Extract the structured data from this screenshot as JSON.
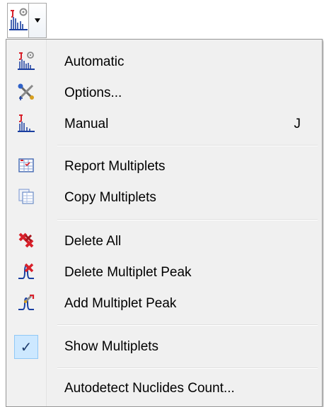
{
  "toolbar": {
    "button_icon": "multiplet-auto-icon",
    "dropdown_icon": "chevron-down-icon"
  },
  "menu": {
    "groups": [
      {
        "items": [
          {
            "label": "Automatic",
            "icon": "multiplet-auto-icon",
            "shortcut": ""
          },
          {
            "label": "Options...",
            "icon": "options-wrench-icon",
            "shortcut": ""
          },
          {
            "label": "Manual",
            "icon": "multiplet-manual-icon",
            "shortcut": "J"
          }
        ]
      },
      {
        "items": [
          {
            "label": "Report Multiplets",
            "icon": "report-table-icon",
            "shortcut": ""
          },
          {
            "label": "Copy Multiplets",
            "icon": "copy-table-icon",
            "shortcut": ""
          }
        ]
      },
      {
        "items": [
          {
            "label": "Delete All",
            "icon": "delete-all-icon",
            "shortcut": ""
          },
          {
            "label": "Delete Multiplet Peak",
            "icon": "delete-peak-icon",
            "shortcut": ""
          },
          {
            "label": "Add Multiplet Peak",
            "icon": "add-peak-icon",
            "shortcut": ""
          }
        ]
      },
      {
        "items": [
          {
            "label": "Show Multiplets",
            "icon": "checkmark-icon",
            "shortcut": "",
            "checked": true
          }
        ]
      },
      {
        "items": [
          {
            "label": "Autodetect Nuclides Count...",
            "icon": "",
            "shortcut": ""
          }
        ]
      }
    ]
  },
  "colors": {
    "menu_background": "#f0f0f0",
    "check_highlight": "#cde8ff",
    "icon_red": "#d8202a",
    "icon_blue": "#1a3fa0"
  }
}
